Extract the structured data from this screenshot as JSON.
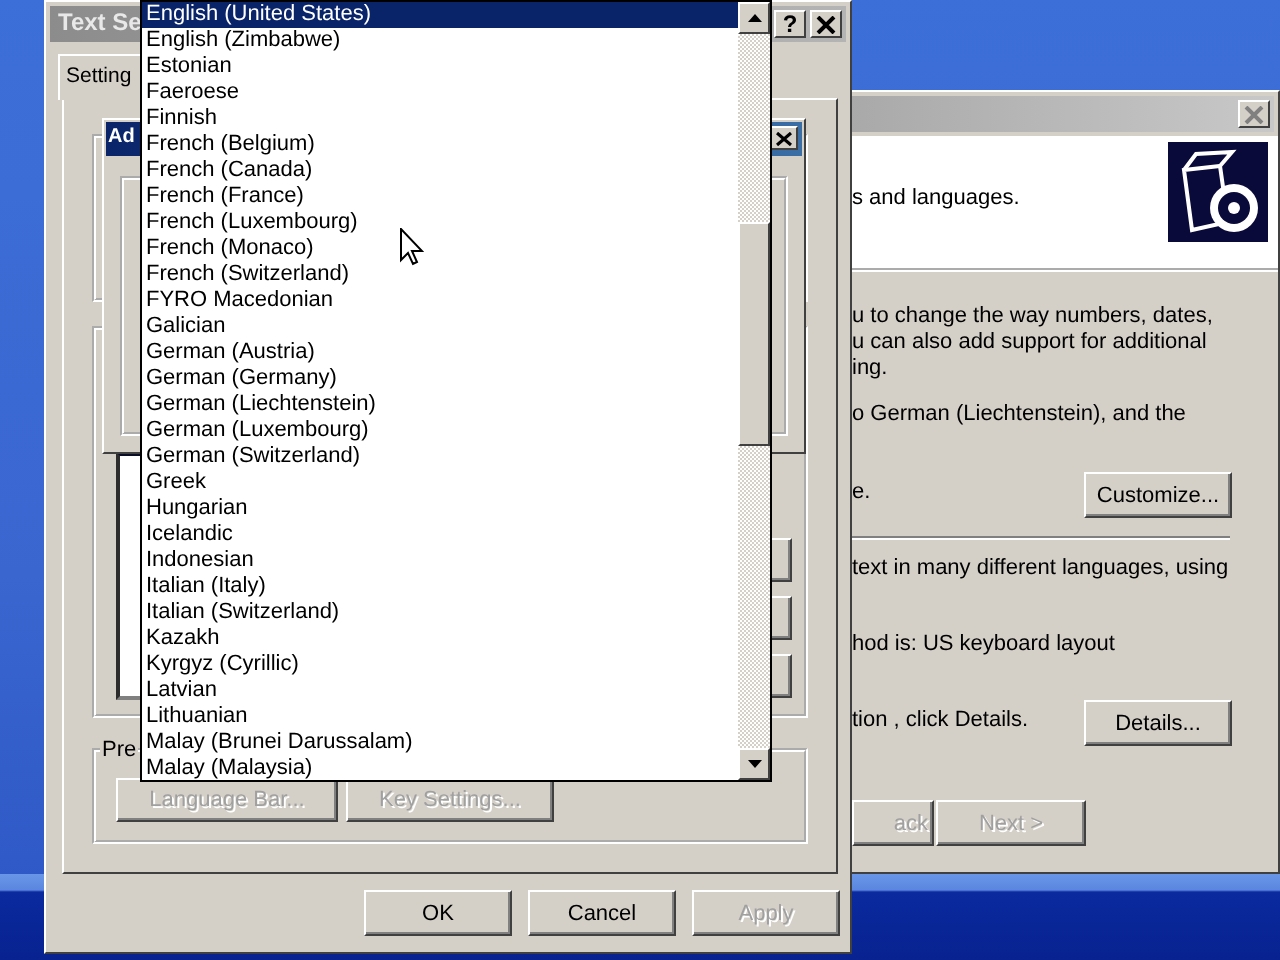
{
  "regional_window": {
    "header_text": "s and languages.",
    "intro_text": "u to change the way numbers, dates,\nu can also add support for additional\ning.",
    "setting_text": "o German (Liechtenstein), and the",
    "setting_tail": "e.",
    "customize_button": {
      "label": "Customize...",
      "disabled": false
    },
    "input_text": "text in many different languages, using",
    "method_text": "hod is: US keyboard layout",
    "details_text": "tion , click Details.",
    "details_button": {
      "label": "Details...",
      "disabled": false
    },
    "nav_buttons": [
      {
        "label": "ack",
        "disabled": true
      },
      {
        "label": "Next >",
        "disabled": true
      }
    ]
  },
  "text_services_window": {
    "title": "Text Se",
    "help": "?",
    "tabs": [
      {
        "label": "Setting",
        "selected": true
      }
    ],
    "inner_dialog": {
      "title": "Ad"
    },
    "preferences_label": "Pre",
    "preference_buttons": [
      {
        "label": "Language Bar...",
        "disabled": true
      },
      {
        "label": "Key Settings...",
        "disabled": true
      }
    ],
    "buttons": [
      {
        "label": "OK",
        "disabled": false
      },
      {
        "label": "Cancel",
        "disabled": false
      },
      {
        "label": "Apply",
        "disabled": true
      }
    ]
  },
  "language_list": [
    {
      "label": "English (United States)",
      "selected": true
    },
    {
      "label": "English (Zimbabwe)",
      "selected": false
    },
    {
      "label": "Estonian",
      "selected": false
    },
    {
      "label": "Faeroese",
      "selected": false
    },
    {
      "label": "Finnish",
      "selected": false
    },
    {
      "label": "French (Belgium)",
      "selected": false
    },
    {
      "label": "French (Canada)",
      "selected": false
    },
    {
      "label": "French (France)",
      "selected": false
    },
    {
      "label": "French (Luxembourg)",
      "selected": false
    },
    {
      "label": "French (Monaco)",
      "selected": false
    },
    {
      "label": "French (Switzerland)",
      "selected": false
    },
    {
      "label": "FYRO Macedonian",
      "selected": false
    },
    {
      "label": "Galician",
      "selected": false
    },
    {
      "label": "German (Austria)",
      "selected": false
    },
    {
      "label": "German (Germany)",
      "selected": false
    },
    {
      "label": "German (Liechtenstein)",
      "selected": false
    },
    {
      "label": "German (Luxembourg)",
      "selected": false
    },
    {
      "label": "German (Switzerland)",
      "selected": false
    },
    {
      "label": "Greek",
      "selected": false
    },
    {
      "label": "Hungarian",
      "selected": false
    },
    {
      "label": "Icelandic",
      "selected": false
    },
    {
      "label": "Indonesian",
      "selected": false
    },
    {
      "label": "Italian (Italy)",
      "selected": false
    },
    {
      "label": "Italian (Switzerland)",
      "selected": false
    },
    {
      "label": "Kazakh",
      "selected": false
    },
    {
      "label": "Kyrgyz (Cyrillic)",
      "selected": false
    },
    {
      "label": "Latvian",
      "selected": false
    },
    {
      "label": "Lithuanian",
      "selected": false
    },
    {
      "label": "Malay (Brunei Darussalam)",
      "selected": false
    },
    {
      "label": "Malay (Malaysia)",
      "selected": false
    }
  ]
}
